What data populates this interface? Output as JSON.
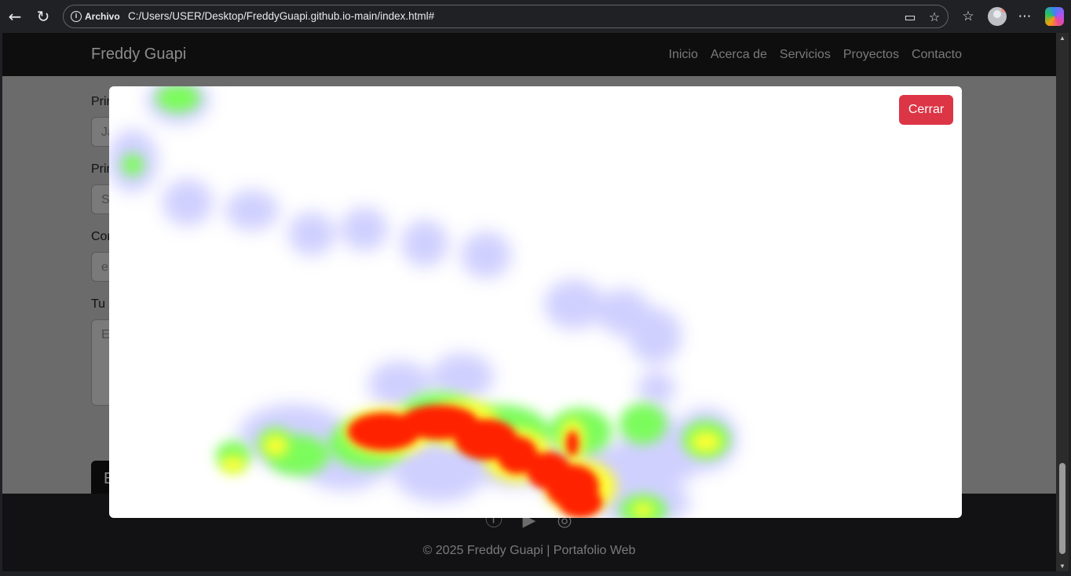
{
  "browser": {
    "scheme_label": "Archivo",
    "url": "C:/Users/USER/Desktop/FreddyGuapi.github.io-main/index.html#"
  },
  "site": {
    "brand": "Freddy Guapi",
    "nav": [
      "Inicio",
      "Acerca de",
      "Servicios",
      "Proyectos",
      "Contacto"
    ]
  },
  "form": {
    "labels": [
      "Prim",
      "Prim",
      "Cor",
      "Tu"
    ],
    "input_values": [
      "Ja",
      "S",
      "e",
      "E"
    ],
    "submit_label": "E"
  },
  "footer": {
    "social_icons": [
      "facebook-icon",
      "youtube-icon",
      "instagram-icon"
    ],
    "copyright": "© 2025 Freddy Guapi | Portafolio Web"
  },
  "modal": {
    "close_label": "Cerrar",
    "heatmap_colors": {
      "low": "#c8c8ff",
      "mid": "#7cfc5c",
      "high": "#ffff33",
      "max": "#ff2200"
    }
  }
}
